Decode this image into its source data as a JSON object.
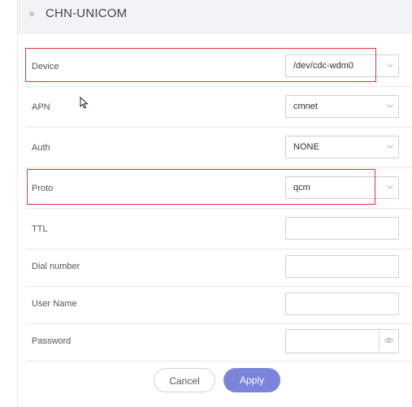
{
  "header": {
    "title": "CHN-UNICOM"
  },
  "form": {
    "device": {
      "label": "Device",
      "value": "/dev/cdc-wdm0"
    },
    "apn": {
      "label": "APN",
      "value": "cmnet"
    },
    "auth": {
      "label": "Auth",
      "value": "NONE"
    },
    "proto": {
      "label": "Proto",
      "value": "qcm"
    },
    "ttl": {
      "label": "TTL",
      "value": ""
    },
    "dial_number": {
      "label": "Dial number",
      "value": ""
    },
    "user_name": {
      "label": "User Name",
      "value": ""
    },
    "password": {
      "label": "Password",
      "value": ""
    }
  },
  "buttons": {
    "cancel": "Cancel",
    "apply": "Apply"
  },
  "colors": {
    "accent": "#7b84d8",
    "highlight": "#d93838",
    "header_bg": "#f2f3f6"
  }
}
